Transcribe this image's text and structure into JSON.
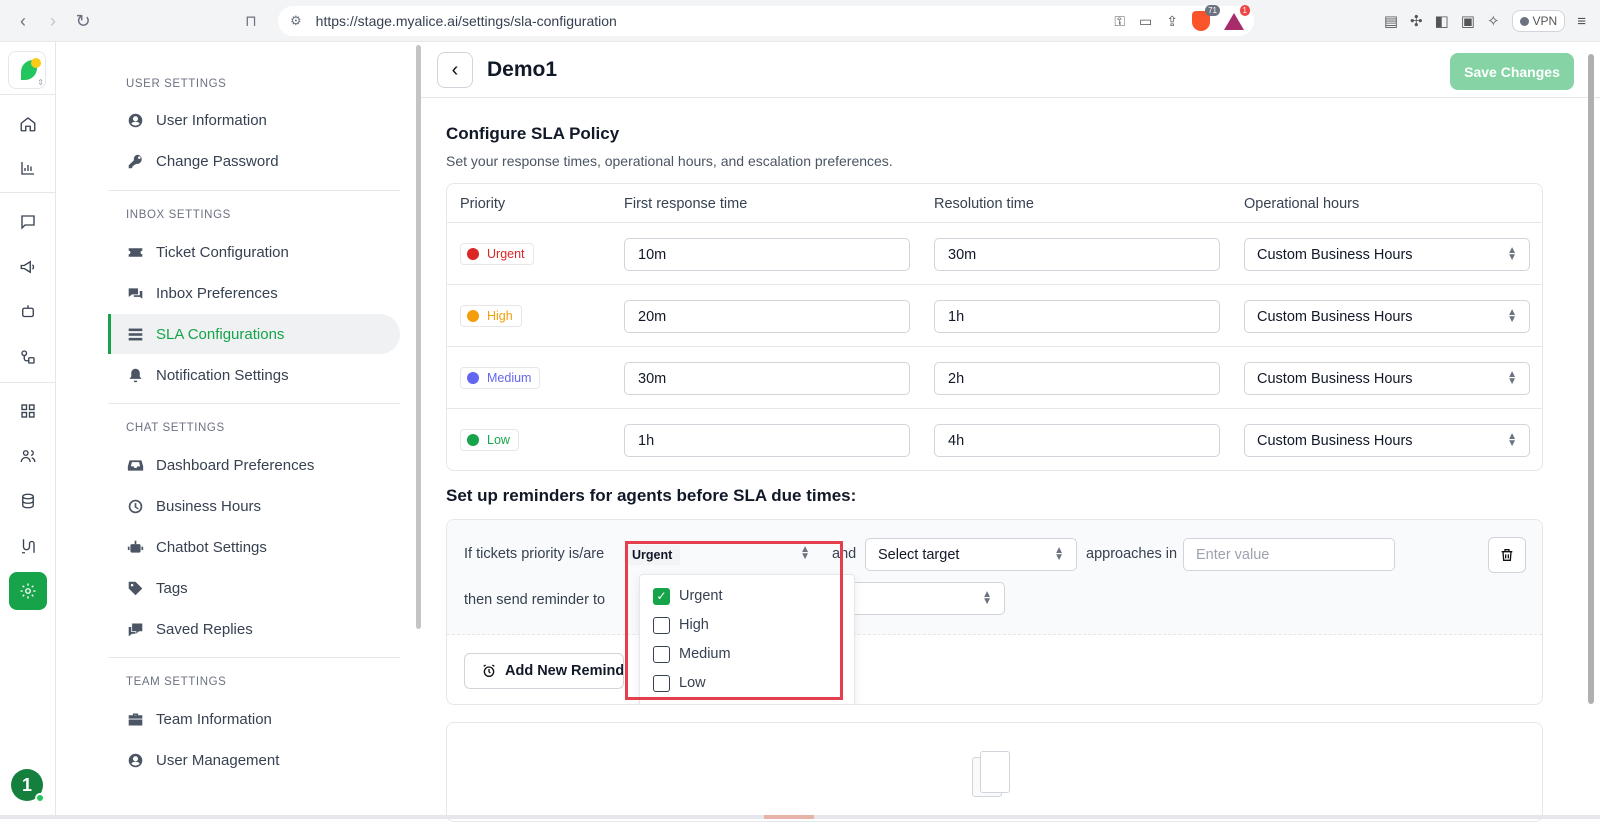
{
  "browser": {
    "url": "https://stage.myalice.ai/settings/sla-configuration",
    "brave_count": "71",
    "rewards_count": "1",
    "vpn_label": "VPN"
  },
  "rail": {
    "avatar_initial": "1"
  },
  "sidebar": {
    "sections": [
      {
        "heading": "USER SETTINGS",
        "items": [
          {
            "label": "User Information",
            "icon": "user-circle-icon"
          },
          {
            "label": "Change Password",
            "icon": "key-icon"
          }
        ]
      },
      {
        "heading": "INBOX SETTINGS",
        "items": [
          {
            "label": "Ticket Configuration",
            "icon": "ticket-icon"
          },
          {
            "label": "Inbox Preferences",
            "icon": "chat-bubbles-icon"
          },
          {
            "label": "SLA Configurations",
            "icon": "list-icon",
            "active": true
          },
          {
            "label": "Notification Settings",
            "icon": "bell-icon"
          }
        ]
      },
      {
        "heading": "CHAT SETTINGS",
        "items": [
          {
            "label": "Dashboard Preferences",
            "icon": "inbox-tray-icon"
          },
          {
            "label": "Business Hours",
            "icon": "clock-icon"
          },
          {
            "label": "Chatbot Settings",
            "icon": "robot-icon"
          },
          {
            "label": "Tags",
            "icon": "tag-icon"
          },
          {
            "label": "Saved Replies",
            "icon": "saved-replies-icon"
          }
        ]
      },
      {
        "heading": "TEAM SETTINGS",
        "items": [
          {
            "label": "Team Information",
            "icon": "briefcase-icon"
          },
          {
            "label": "User Management",
            "icon": "user-circle-icon"
          }
        ]
      }
    ]
  },
  "header": {
    "title": "Demo1",
    "save_label": "Save Changes"
  },
  "config": {
    "title": "Configure SLA Policy",
    "subtitle": "Set your response times, operational hours, and escalation preferences.",
    "columns": [
      "Priority",
      "First response time",
      "Resolution time",
      "Operational hours"
    ],
    "rows": [
      {
        "priority": "Urgent",
        "color": "#dc2626",
        "first_response": "10m",
        "resolution": "30m",
        "hours": "Custom Business Hours"
      },
      {
        "priority": "High",
        "color": "#f59e0b",
        "first_response": "20m",
        "resolution": "1h",
        "hours": "Custom Business Hours"
      },
      {
        "priority": "Medium",
        "color": "#6366f1",
        "first_response": "30m",
        "resolution": "2h",
        "hours": "Custom Business Hours"
      },
      {
        "priority": "Low",
        "color": "#16a34a",
        "first_response": "1h",
        "resolution": "4h",
        "hours": "Custom Business Hours"
      }
    ]
  },
  "reminders": {
    "title": "Set up reminders for agents before SLA due times:",
    "if_label": "If tickets priority is/are",
    "selected_chip": "Urgent",
    "and_label": "and",
    "target_placeholder": "Select target",
    "approaches_label": "approaches in",
    "value_placeholder": "Enter value",
    "then_label": "then send reminder to",
    "add_label": "Add New Reminder",
    "options": [
      {
        "label": "Urgent",
        "checked": true
      },
      {
        "label": "High",
        "checked": false
      },
      {
        "label": "Medium",
        "checked": false
      },
      {
        "label": "Low",
        "checked": false
      }
    ]
  },
  "colors": {
    "accent": "#16a34a",
    "save_disabled": "#86d4a6",
    "highlight_outline": "#e53e4d"
  }
}
